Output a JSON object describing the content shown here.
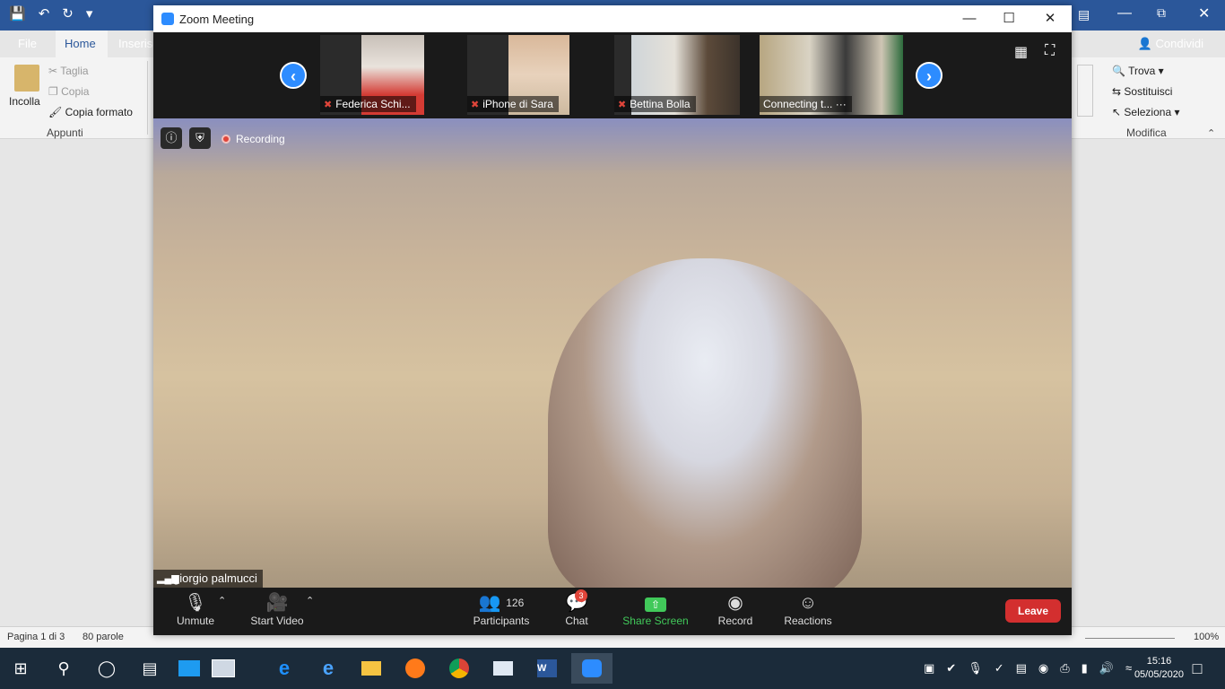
{
  "word": {
    "tabs": [
      "File",
      "Home",
      "Inserisci"
    ],
    "share": "Condividi",
    "ribbon": {
      "paste": "Incolla",
      "cut": "Taglia",
      "copy": "Copia",
      "format_painter": "Copia formato",
      "clipboard_group": "Appunti",
      "find": "Trova",
      "replace": "Sostituisci",
      "select": "Seleziona",
      "editing_group": "Modifica"
    },
    "status": {
      "page": "Pagina 1 di 3",
      "words": "80 parole",
      "zoom": "100%"
    }
  },
  "taskbar": {
    "time": "15:16",
    "date": "05/05/2020"
  },
  "zoom": {
    "title": "Zoom Meeting",
    "participants_strip": [
      {
        "name": "Federica Schi...",
        "muted": true
      },
      {
        "name": "iPhone di Sara",
        "muted": true
      },
      {
        "name": "Bettina Bolla",
        "muted": true
      },
      {
        "name": "Connecting t...",
        "muted": false
      }
    ],
    "recording_label": "Recording",
    "speaker_name": "giorgio palmucci",
    "toolbar": {
      "unmute": "Unmute",
      "start_video": "Start Video",
      "participants": "Participants",
      "participants_count": "126",
      "chat": "Chat",
      "chat_badge": "3",
      "share_screen": "Share Screen",
      "record": "Record",
      "reactions": "Reactions",
      "leave": "Leave"
    },
    "colors": {
      "accent": "#2d8cff",
      "leave": "#d32f2f",
      "share": "#41c95a"
    }
  }
}
